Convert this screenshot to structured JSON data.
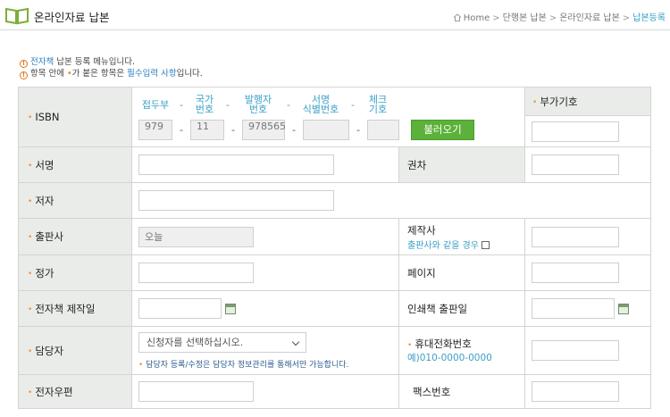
{
  "header": {
    "title": "온라인자료 납본",
    "breadcrumb": [
      "Home",
      "단행본 납본",
      "온라인자료 납본",
      "납본등록"
    ],
    "separator": ">"
  },
  "notes": {
    "line1_prefix": "전자책",
    "line1_suffix": " 납본 등록 메뉴입니다.",
    "line2_a": "항목 안에 ",
    "line2_star": "•",
    "line2_b": "가 붙은 항목은 ",
    "line2_req": "필수입력 사항",
    "line2_c": "입니다."
  },
  "form": {
    "isbn": {
      "label": "ISBN",
      "heads": [
        "접두부",
        "국가\n번호",
        "발행자\n번호",
        "서명\n식별번호",
        "체크\n기호"
      ],
      "dash": "-",
      "values": [
        "979",
        "11",
        "978565",
        "",
        ""
      ],
      "load_button": "불러오기"
    },
    "additional_code": {
      "label": "부가기호",
      "value": ""
    },
    "title": {
      "label": "서명",
      "value": ""
    },
    "volume": {
      "label": "권차",
      "value": ""
    },
    "author": {
      "label": "저자",
      "value": ""
    },
    "publisher": {
      "label": "출판사",
      "value": "오늘"
    },
    "producer": {
      "label": "제작사",
      "same_label": "출판사와 같을 경우",
      "value": ""
    },
    "price": {
      "label": "정가",
      "value": ""
    },
    "pages": {
      "label": "페이지",
      "value": ""
    },
    "ebook_date": {
      "label": "전자책 제작일",
      "value": ""
    },
    "print_date": {
      "label": "인쇄책 출판일",
      "value": ""
    },
    "manager": {
      "label": "담당자",
      "select_value": "신청자를 선택하십시오.",
      "hint_dot": "•",
      "hint": " 담당자 등록/수정은 담당자 정보관리를 통해서만 가능합니다."
    },
    "mobile": {
      "label": "휴대전화번호",
      "example": "예)010-0000-0000",
      "value": ""
    },
    "email": {
      "label": "전자우편",
      "value": ""
    },
    "fax": {
      "label": "팩스번호",
      "value": ""
    }
  },
  "colors": {
    "label_bg": "#eaecea",
    "accent_blue": "#3aa0c6",
    "required_star": "#e89a3a",
    "button_green": "#5cb13a"
  }
}
